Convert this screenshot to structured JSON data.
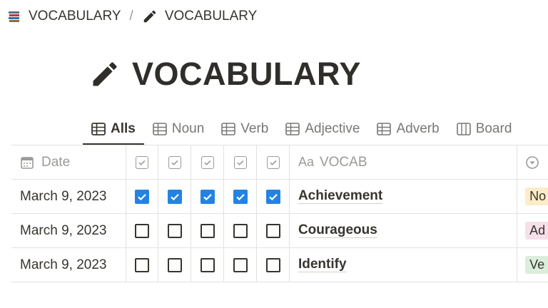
{
  "breadcrumb": {
    "parent": {
      "label": "VOCABULARY",
      "icon": "books-icon"
    },
    "separator": "/",
    "current": {
      "label": "VOCABULARY",
      "icon": "pencil-icon"
    }
  },
  "page": {
    "title": "VOCABULARY",
    "icon": "pencil-icon"
  },
  "tabs": [
    {
      "label": "Alls",
      "icon": "table-icon",
      "active": true
    },
    {
      "label": "Noun",
      "icon": "table-icon"
    },
    {
      "label": "Verb",
      "icon": "table-icon"
    },
    {
      "label": "Adjective",
      "icon": "table-icon"
    },
    {
      "label": "Adverb",
      "icon": "table-icon"
    },
    {
      "label": "Board",
      "icon": "board-icon"
    }
  ],
  "table": {
    "headers": {
      "date": "Date",
      "vocab_prefix": "Aa",
      "vocab": "VOCAB"
    },
    "rows": [
      {
        "date": "March 9, 2023",
        "checks": [
          true,
          true,
          true,
          true,
          true
        ],
        "vocab": "Achievement",
        "type": "No",
        "type_color": "#fdecc8"
      },
      {
        "date": "March 9, 2023",
        "checks": [
          false,
          false,
          false,
          false,
          false
        ],
        "vocab": "Courageous",
        "type": "Ad",
        "type_color": "#f5e0e9"
      },
      {
        "date": "March 9, 2023",
        "checks": [
          false,
          false,
          false,
          false,
          false
        ],
        "vocab": "Identify",
        "type": "Ve",
        "type_color": "#dbeddb"
      }
    ]
  },
  "colors": {
    "accent": "#2383e2",
    "text": "#37352f",
    "muted": "#9b9a97",
    "border": "#e3e2e0"
  }
}
